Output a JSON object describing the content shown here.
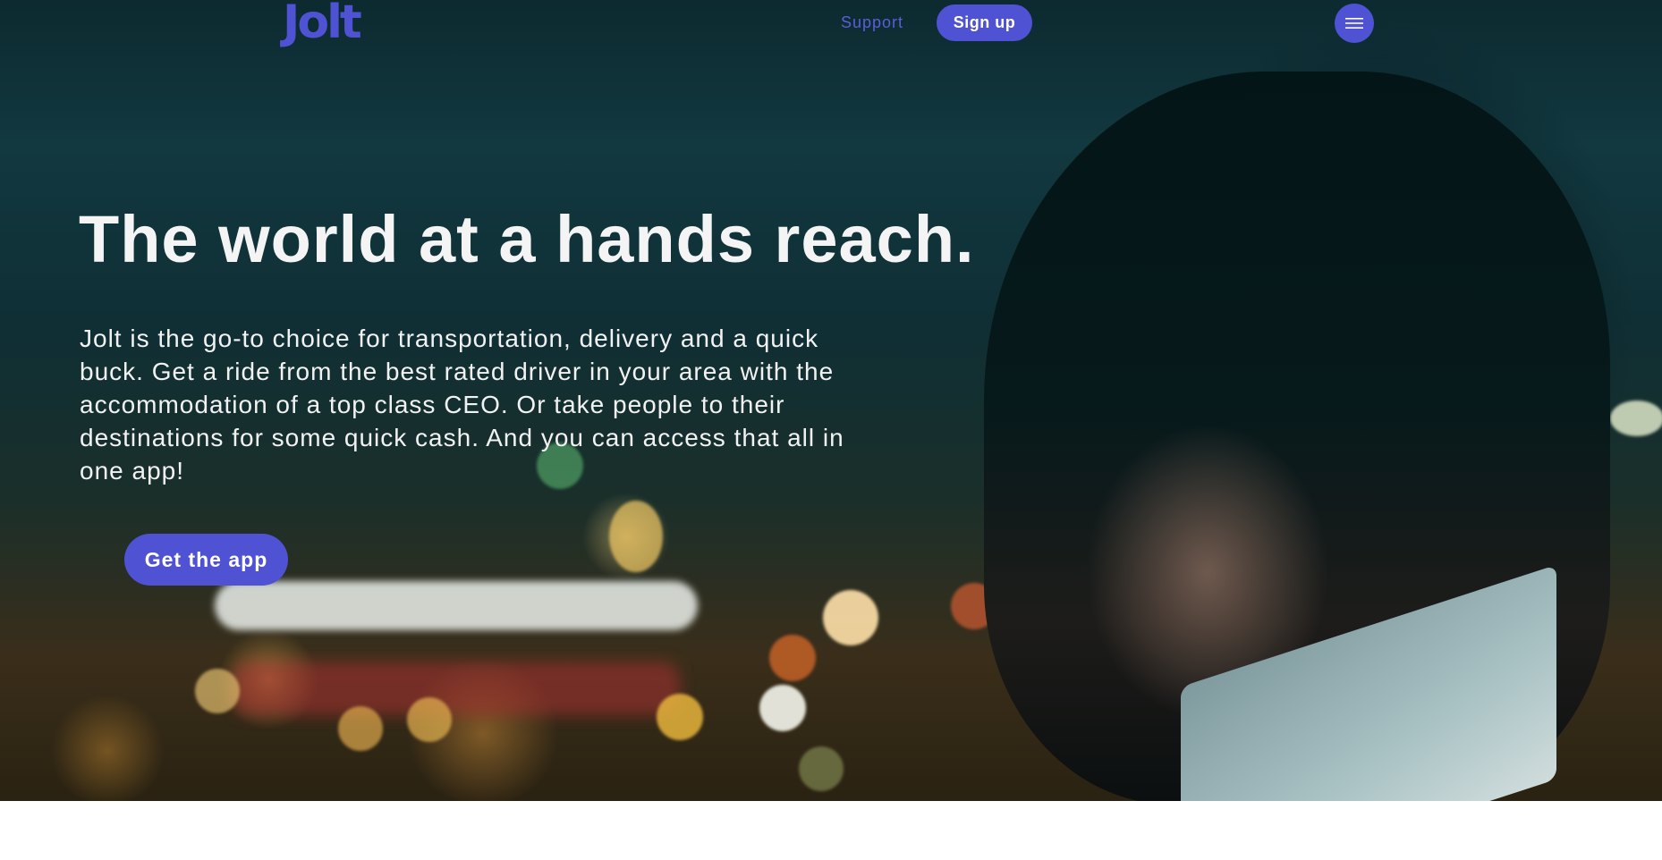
{
  "brand": {
    "logo_text": "Jolt",
    "accent_color": "#4f52d3"
  },
  "nav": {
    "support_label": "Support",
    "signup_label": "Sign up",
    "menu_icon": "hamburger-menu-icon"
  },
  "hero": {
    "headline": "The world at a hands reach.",
    "description": "Jolt is the go-to choice for transportation, delivery and a quick buck. Get a ride from the best rated driver in your area with the accommodation of a top class CEO. Or take people to their destinations for some quick cash. And you can access that all in one app!",
    "cta_label": "Get the app",
    "background_image": "night-city-passenger-photo"
  }
}
